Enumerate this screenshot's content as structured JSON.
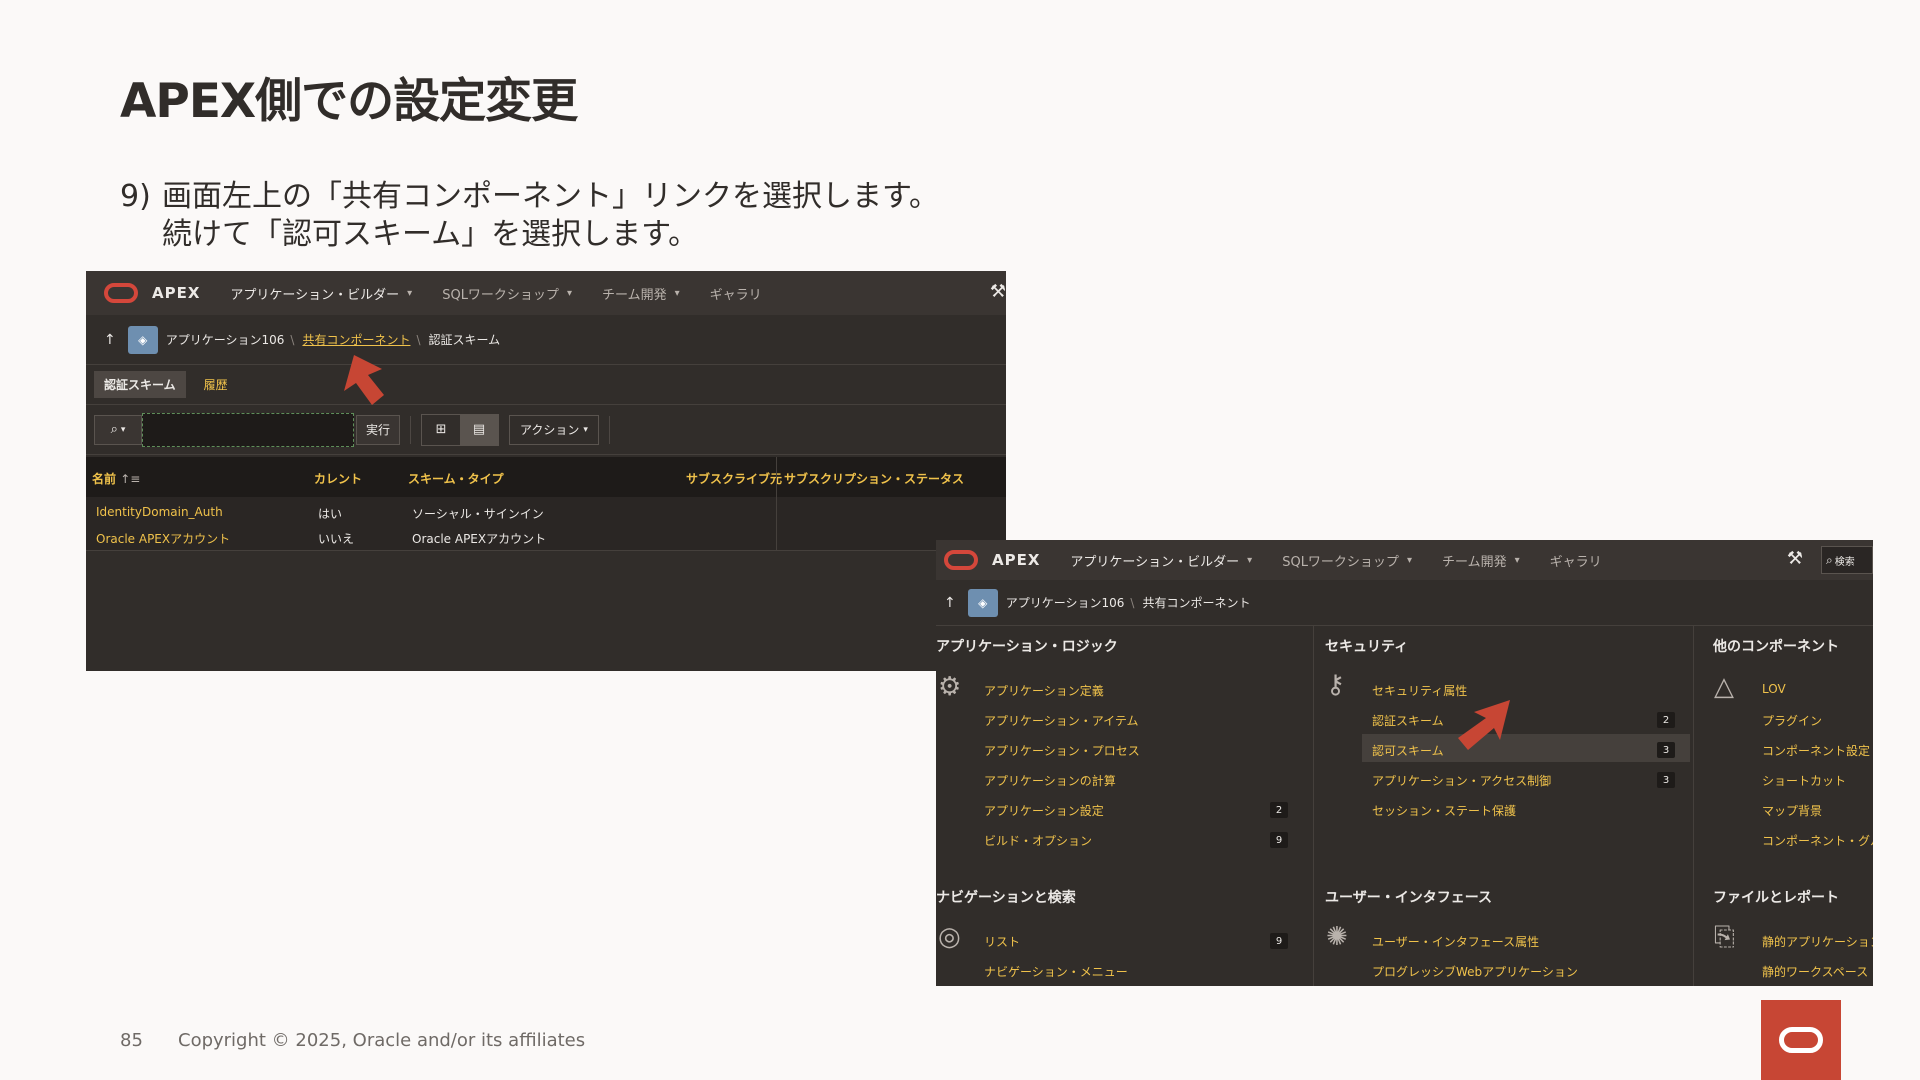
{
  "slide": {
    "title": "APEX側での設定変更",
    "step_number": "9)",
    "step_line1": "画面左上の「共有コンポーネント」リンクを選択します。",
    "step_line2": "続けて「認可スキーム」を選択します。",
    "page_number": "85",
    "copyright": "Copyright © 2025, Oracle and/or its affiliates"
  },
  "apex": {
    "brand": "APEX",
    "nav": {
      "app_builder": "アプリケーション・ビルダー",
      "sql_workshop": "SQLワークショップ",
      "team_dev": "チーム開発",
      "gallery": "ギャラリ"
    },
    "search_label": "検索"
  },
  "shot1": {
    "breadcrumb": {
      "app": "アプリケーション106",
      "shared": "共有コンポーネント",
      "current": "認証スキーム"
    },
    "tabs": {
      "active": "認証スキーム",
      "history": "履歴"
    },
    "toolbar": {
      "go": "実行",
      "actions": "アクション"
    },
    "columns": {
      "name": "名前",
      "current": "カレント",
      "scheme_type": "スキーム・タイプ",
      "subscribed_from": "サブスクライブ元",
      "subscription_status": "サブスクリプション・ステータス"
    },
    "rows": [
      {
        "name": "IdentityDomain_Auth",
        "current": "はい",
        "type": "ソーシャル・サインイン"
      },
      {
        "name": "Oracle APEXアカウント",
        "current": "いいえ",
        "type": "Oracle APEXアカウント"
      }
    ]
  },
  "shot2": {
    "breadcrumb": {
      "app": "アプリケーション106",
      "current": "共有コンポーネント"
    },
    "sections": {
      "app_logic": {
        "title": "アプリケーション・ロジック",
        "items": [
          {
            "label": "アプリケーション定義",
            "count": ""
          },
          {
            "label": "アプリケーション・アイテム",
            "count": ""
          },
          {
            "label": "アプリケーション・プロセス",
            "count": ""
          },
          {
            "label": "アプリケーションの計算",
            "count": ""
          },
          {
            "label": "アプリケーション設定",
            "count": "2"
          },
          {
            "label": "ビルド・オプション",
            "count": "9"
          }
        ]
      },
      "security": {
        "title": "セキュリティ",
        "items": [
          {
            "label": "セキュリティ属性",
            "count": ""
          },
          {
            "label": "認証スキーム",
            "count": "2"
          },
          {
            "label": "認可スキーム",
            "count": "3"
          },
          {
            "label": "アプリケーション・アクセス制御",
            "count": "3"
          },
          {
            "label": "セッション・ステート保護",
            "count": ""
          }
        ]
      },
      "other": {
        "title": "他のコンポーネント",
        "items": [
          {
            "label": "LOV"
          },
          {
            "label": "プラグイン"
          },
          {
            "label": "コンポーネント設定"
          },
          {
            "label": "ショートカット"
          },
          {
            "label": "マップ背景"
          },
          {
            "label": "コンポーネント・グループ"
          }
        ]
      },
      "nav_search": {
        "title": "ナビゲーションと検索",
        "items": [
          {
            "label": "リスト",
            "count": "9"
          },
          {
            "label": "ナビゲーション・メニュー",
            "count": ""
          }
        ]
      },
      "ui": {
        "title": "ユーザー・インタフェース",
        "items": [
          {
            "label": "ユーザー・インタフェース属性"
          },
          {
            "label": "プログレッシブWebアプリケーション"
          }
        ]
      },
      "files": {
        "title": "ファイルとレポート",
        "items": [
          {
            "label": "静的アプリケーション・ファイル"
          },
          {
            "label": "静的ワークスペース・ファイル"
          }
        ]
      }
    }
  }
}
